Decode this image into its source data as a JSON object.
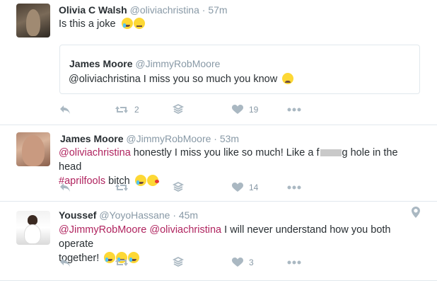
{
  "tweets": [
    {
      "name": "Olivia C Walsh",
      "handle": "@oliviachristina",
      "time": "· 57m",
      "text": "Is this a joke",
      "quote": {
        "name": "James Moore",
        "handle": "@JimmyRobMoore",
        "mention": "@oliviachristina",
        "text": " I miss you so much you know"
      },
      "actions": {
        "retweets": "2",
        "likes": "19"
      }
    },
    {
      "name": "James Moore",
      "handle": "@JimmyRobMoore",
      "time": "· 53m",
      "mention": "@oliviachristina",
      "text1": " honestly I miss you like so much! Like a f",
      "text2": "g hole in the head",
      "hashtag": "#aprilfools",
      "text3": " bitch",
      "actions": {
        "retweets": "",
        "likes": "14"
      }
    },
    {
      "name": "Youssef",
      "handle": "@YoyoHassane",
      "time": "· 45m",
      "mention1": "@JimmyRobMoore",
      "mention2": "@oliviachristina",
      "text1": " I will never understand how you both operate",
      "text2": "together!",
      "actions": {
        "retweets": "",
        "likes": "3"
      }
    }
  ],
  "icons": [
    "reply-icon",
    "retweet-icon",
    "stack-icon",
    "heart-icon",
    "more-icon",
    "location-pin-icon"
  ],
  "colors": {
    "link": "#b0245f",
    "muted": "#8899a6",
    "icon": "#aab8c2",
    "border": "#e1e8ed"
  }
}
